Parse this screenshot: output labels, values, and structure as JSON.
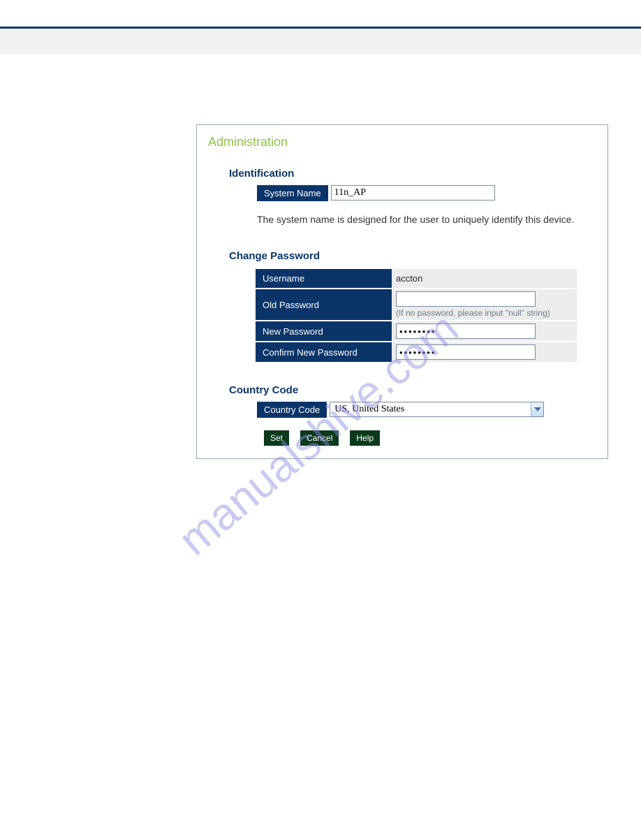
{
  "page_title": "Administration",
  "identification": {
    "heading": "Identification",
    "system_name_label": "System Name",
    "system_name_value": "11n_AP",
    "helper": "The system name is designed for the user to uniquely identify this device."
  },
  "change_password": {
    "heading": "Change Password",
    "username_label": "Username",
    "username_value": "accton",
    "old_password_label": "Old Password",
    "old_password_value": "",
    "old_password_hint": "(If no password, please input \"null\" string)",
    "new_password_label": "New Password",
    "new_password_value": "••••••••",
    "confirm_password_label": "Confirm New Password",
    "confirm_password_value": "••••••••"
  },
  "country_code": {
    "heading": "Country Code",
    "label": "Country Code",
    "selected": "US, United States"
  },
  "buttons": {
    "set": "Set",
    "cancel": "Cancel",
    "help": "Help"
  },
  "watermark": "manualshive.com"
}
